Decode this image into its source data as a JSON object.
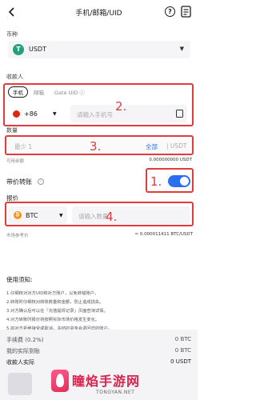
{
  "header": {
    "title": "手机/邮箱/UID",
    "help_symbol": "?",
    "icons": [
      "back-icon",
      "help-icon",
      "document-icon"
    ]
  },
  "currency": {
    "label": "币种",
    "selected": "USDT",
    "icon_letter": "T"
  },
  "recipient": {
    "label": "收款人",
    "tabs": [
      {
        "label": "手机",
        "active": true
      },
      {
        "label": "邮箱",
        "active": false
      },
      {
        "label": "Gate UID ⓘ",
        "active": false
      }
    ],
    "country_code": "+86",
    "phone_placeholder": "请输入手机号"
  },
  "amount": {
    "label": "数量",
    "placeholder": "最少 1",
    "all_label": "全部",
    "unit": "| USDT",
    "available_label": "可用余额",
    "available_value": "0.000000000 USDT"
  },
  "quote_transfer": {
    "label": "带价转账",
    "enabled": true,
    "info_symbol": "i"
  },
  "quote": {
    "label": "报价",
    "currency": "BTC",
    "icon_letter": "₿",
    "input_placeholder": "请输入数量",
    "reference_label": "市场参考价",
    "reference_value": "≈ 0.000011411 BTC/USDT"
  },
  "annotations": [
    "1.",
    "2.",
    "3.",
    "4."
  ],
  "notes": {
    "title": "使用须知:",
    "items": [
      "1.仔细核对对方UID和对方账户，以免转错账户。",
      "2.转账时仔细核对转账数量和金额，防止造成损失。",
      "3.对方确认后可以在「充值提现记录」页面查询详情。",
      "4.对方转账时报价将按照实际市场价格发生变化。",
      "5.如对方拒绝接受或取消，冻结的资金会退回您的账户。"
    ]
  },
  "summary": {
    "fee_label": "手续费 (0.2%)",
    "fee_value": "0 BTC",
    "actual_pay_label": "我的实际到账",
    "actual_pay_value": "0 BTC",
    "receiver_label": "收款人实际",
    "receiver_value": "0 USDT"
  },
  "watermark": {
    "title": "瞳焰手游网",
    "domain": "TONGYAN.NET"
  },
  "colors": {
    "annotation_red": "#e23b3b",
    "accent_blue": "#2b6ff0",
    "usdt_green": "#26a17b",
    "btc_orange": "#f7931a"
  }
}
